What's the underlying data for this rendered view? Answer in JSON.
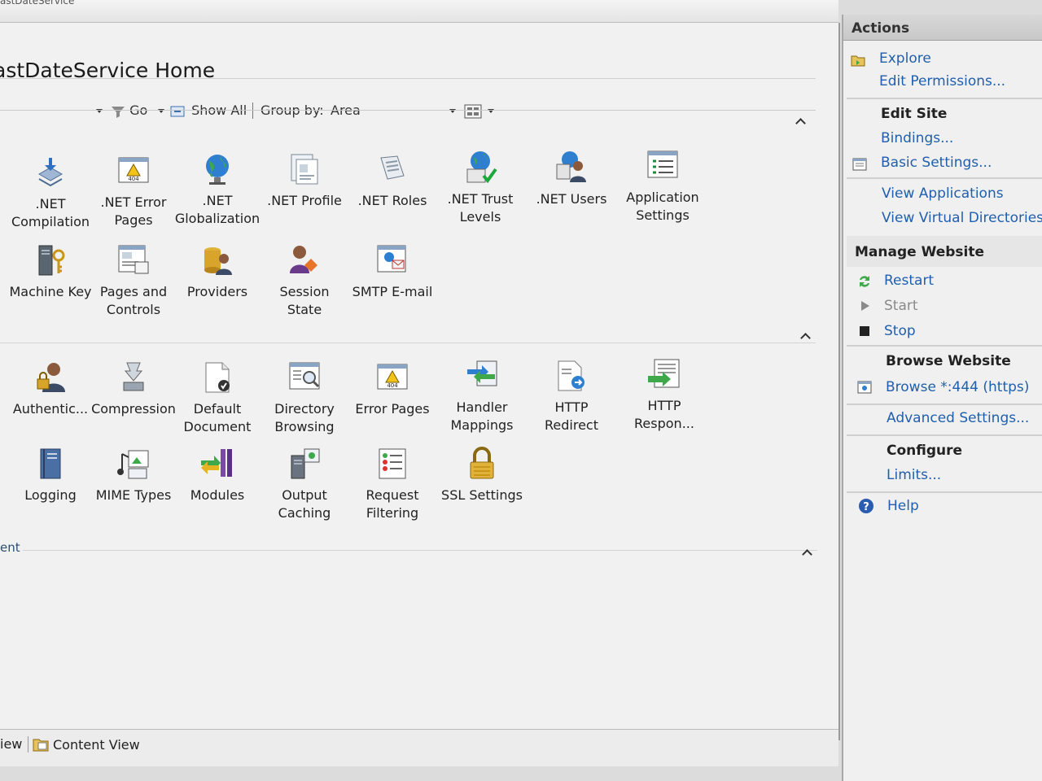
{
  "window": {
    "tab_text": "astDateService"
  },
  "header": {
    "title": "astDateService Home"
  },
  "filterbar": {
    "go_label": "Go",
    "show_all_label": "Show All",
    "group_by_label": "Group by:",
    "group_by_value": "Area"
  },
  "features_row1": [
    {
      "label": ".NET Compilation",
      "icon": "compilation-icon"
    },
    {
      "label": ".NET Error Pages",
      "icon": "error-pages-icon"
    },
    {
      "label": ".NET Globalization",
      "icon": "globe-icon"
    },
    {
      "label": ".NET Profile",
      "icon": "profile-icon"
    },
    {
      "label": ".NET Roles",
      "icon": "roles-icon"
    },
    {
      "label": ".NET Trust Levels",
      "icon": "trust-levels-icon"
    },
    {
      "label": ".NET Users",
      "icon": "users-icon"
    },
    {
      "label": "Application Settings",
      "icon": "app-settings-icon"
    }
  ],
  "features_row2": [
    {
      "label": "Machine Key",
      "icon": "machine-key-icon"
    },
    {
      "label": "Pages and Controls",
      "icon": "pages-controls-icon"
    },
    {
      "label": "Providers",
      "icon": "providers-icon"
    },
    {
      "label": "Session State",
      "icon": "session-state-icon"
    },
    {
      "label": "SMTP E-mail",
      "icon": "smtp-email-icon"
    }
  ],
  "features_row3": [
    {
      "label": "Authentic...",
      "icon": "authentication-icon"
    },
    {
      "label": "Compression",
      "icon": "compression-icon"
    },
    {
      "label": "Default Document",
      "icon": "default-document-icon"
    },
    {
      "label": "Directory Browsing",
      "icon": "directory-browsing-icon"
    },
    {
      "label": "Error Pages",
      "icon": "error-pages-icon"
    },
    {
      "label": "Handler Mappings",
      "icon": "handler-mappings-icon"
    },
    {
      "label": "HTTP Redirect",
      "icon": "http-redirect-icon"
    },
    {
      "label": "HTTP Respon...",
      "icon": "http-response-icon"
    }
  ],
  "features_row4": [
    {
      "label": "Logging",
      "icon": "logging-icon"
    },
    {
      "label": "MIME Types",
      "icon": "mime-types-icon"
    },
    {
      "label": "Modules",
      "icon": "modules-icon"
    },
    {
      "label": "Output Caching",
      "icon": "output-caching-icon"
    },
    {
      "label": "Request Filtering",
      "icon": "request-filtering-icon"
    },
    {
      "label": "SSL Settings",
      "icon": "lock-icon"
    }
  ],
  "group_management_label": "ent",
  "bottom": {
    "features_view_label": "iew",
    "content_view_label": "Content View"
  },
  "actions": {
    "header": "Actions",
    "explore": "Explore",
    "edit_permissions": "Edit Permissions...",
    "edit_site_title": "Edit Site",
    "bindings": "Bindings...",
    "basic_settings": "Basic Settings...",
    "view_applications": "View Applications",
    "view_virtual_directories": "View Virtual Directories",
    "manage_website_title": "Manage Website",
    "restart": "Restart",
    "start": "Start",
    "stop": "Stop",
    "browse_website_title": "Browse Website",
    "browse": "Browse *:444 (https)",
    "advanced_settings": "Advanced Settings...",
    "configure_title": "Configure",
    "limits": "Limits...",
    "help": "Help"
  },
  "colors": {
    "link": "#1f5fad",
    "panel": "#f1f1f1",
    "actions_header": "#cccccc"
  }
}
